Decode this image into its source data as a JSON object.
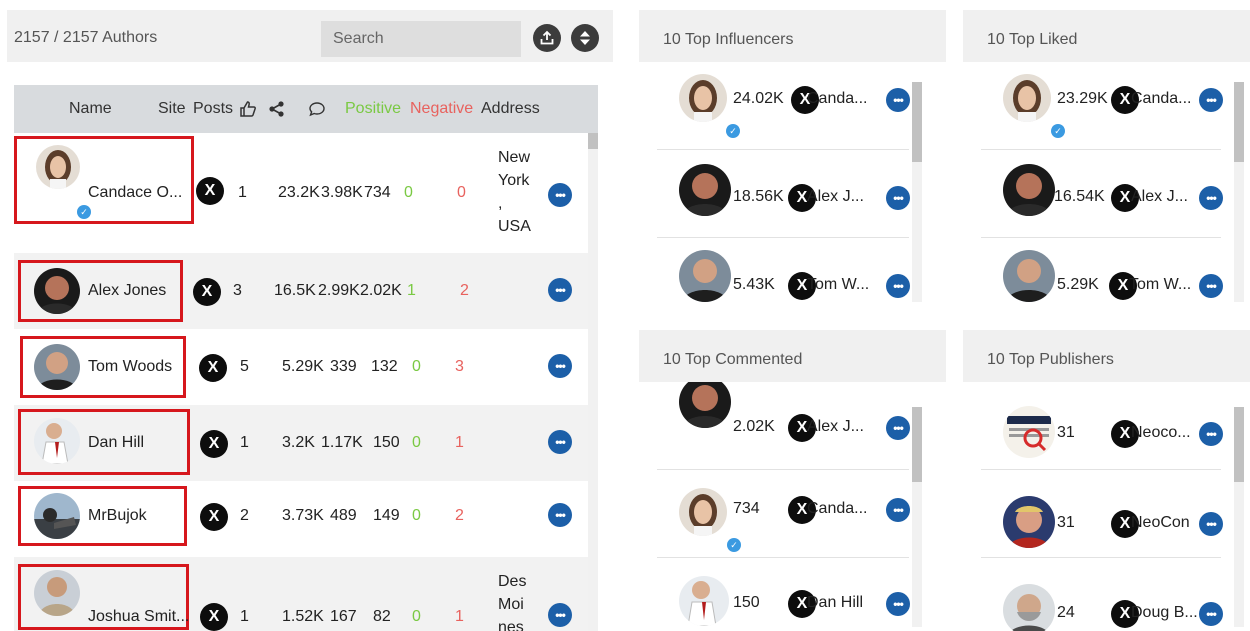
{
  "authors": {
    "count_text": "2157 / 2157 Authors",
    "search_placeholder": "Search",
    "columns": {
      "name": "Name",
      "site": "Site",
      "posts": "Posts",
      "positive": "Positive",
      "negative": "Negative",
      "address": "Address"
    },
    "rows": [
      {
        "name": "Candace O...",
        "posts": "1",
        "likes": "23.2K",
        "shares": "3.98K",
        "comments": "734",
        "positive": "0",
        "negative": "0",
        "address": [
          "New",
          "York",
          ",",
          "USA"
        ]
      },
      {
        "name": "Alex Jones",
        "posts": "3",
        "likes": "16.5K",
        "shares": "2.99K",
        "comments": "2.02K",
        "positive": "1",
        "negative": "2",
        "address": []
      },
      {
        "name": "Tom Woods",
        "posts": "5",
        "likes": "5.29K",
        "shares": "339",
        "comments": "132",
        "positive": "0",
        "negative": "3",
        "address": []
      },
      {
        "name": "Dan Hill",
        "posts": "1",
        "likes": "3.2K",
        "shares": "1.17K",
        "comments": "150",
        "positive": "0",
        "negative": "1",
        "address": []
      },
      {
        "name": "MrBujok",
        "posts": "2",
        "likes": "3.73K",
        "shares": "489",
        "comments": "149",
        "positive": "0",
        "negative": "2",
        "address": []
      },
      {
        "name": "Joshua Smit...",
        "posts": "1",
        "likes": "1.52K",
        "shares": "167",
        "comments": "82",
        "positive": "0",
        "negative": "1",
        "address": [
          "Des",
          "Moi",
          "nes"
        ]
      }
    ]
  },
  "panels": {
    "influencers": {
      "title": "10 Top Influencers",
      "items": [
        {
          "value": "24.02K",
          "name": "Canda..."
        },
        {
          "value": "18.56K",
          "name": "Alex J..."
        },
        {
          "value": "5.43K",
          "name": "Tom W..."
        }
      ]
    },
    "liked": {
      "title": "10 Top Liked",
      "items": [
        {
          "value": "23.29K",
          "name": "Canda..."
        },
        {
          "value": "16.54K",
          "name": "Alex J..."
        },
        {
          "value": "5.29K",
          "name": "Tom W..."
        }
      ]
    },
    "commented": {
      "title": "10 Top Commented",
      "items": [
        {
          "value": "2.02K",
          "name": "Alex J..."
        },
        {
          "value": "734",
          "name": "Canda..."
        },
        {
          "value": "150",
          "name": "Dan Hill"
        }
      ]
    },
    "publishers": {
      "title": "10 Top Publishers",
      "items": [
        {
          "value": "31",
          "name": "Neoco..."
        },
        {
          "value": "31",
          "name": "NeoCon"
        },
        {
          "value": "24",
          "name": "Doug B..."
        }
      ]
    }
  },
  "icons": {
    "upload": "upload-icon",
    "sort": "sort-icon",
    "like": "thumbs-up-icon",
    "share": "share-icon",
    "comment": "comment-icon",
    "x": "x-logo-icon",
    "more": "more-icon",
    "verified": "verified-icon"
  },
  "colors": {
    "positive": "#7ac943",
    "negative": "#e8625e",
    "more_button": "#1c5fa8",
    "highlight": "#d6171d"
  }
}
